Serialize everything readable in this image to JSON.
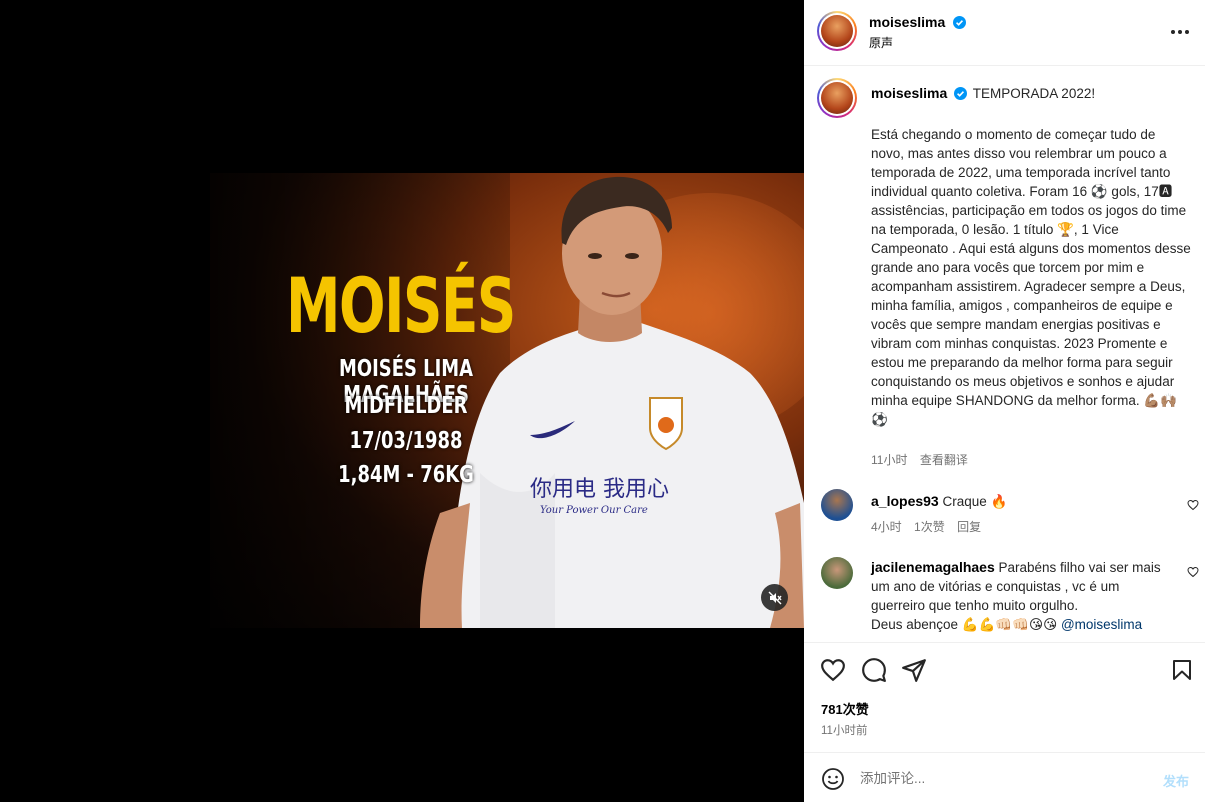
{
  "video": {
    "name": "MOISÉS",
    "full_name": "MOISÉS LIMA MAGALHÃES",
    "position": "MIDFIELDER",
    "birthdate": "17/03/1988",
    "stats": "1,84M - 76KG",
    "shirt_text": "你用电 我用心",
    "shirt_sub": "Your Power Our Care",
    "mute_icon": "volume-muted-icon"
  },
  "header": {
    "username": "moiseslima",
    "verified": true,
    "audio_label": "原声",
    "more_icon": "more-options-icon"
  },
  "caption": {
    "username": "moiseslima",
    "title": "TEMPORADA 2022!",
    "text": "Está chegando o momento de começar tudo de novo, mas antes disso vou relembrar um pouco a temporada de 2022, uma temporada incrível tanto individual quanto coletiva. Foram 16 ⚽ gols, 17🅰 assistências, participação em todos os jogos do time na temporada, 0 lesão. 1 título 🏆, 1 Vice Campeonato . Aqui está alguns dos momentos desse grande ano para vocês que torcem por mim e acompanham assistirem. Agradecer sempre a Deus, minha família, amigos , companheiros de equipe e vocês que sempre mandam energias positivas e vibram com minhas conquistas. 2023 Promente e estou me preparando da melhor forma para seguir conquistando os meus objetivos e sonhos e ajudar minha equipe SHANDONG da melhor forma. 💪🏽🙌🏽⚽",
    "time": "11小时",
    "translate": "查看翻译"
  },
  "comments": [
    {
      "username": "a_lopes93",
      "text": "Craque 🔥",
      "time": "4小时",
      "likes": "1次赞",
      "reply": "回复"
    },
    {
      "username": "jacilenemagalhaes",
      "text": "Parabéns filho vai ser mais um ano de vitórias e conquistas , vc é um guerreiro que tenho muito orgulho.\nDeus abençoe 💪💪👊🏻👊🏻😘😘",
      "mention": "@moiseslima"
    }
  ],
  "actions": {
    "likes": "781次赞",
    "time": "11小时前"
  },
  "add_comment": {
    "placeholder": "添加评论...",
    "post_label": "发布"
  },
  "colors": {
    "title_yellow": "#f5c400",
    "verified_blue": "#0095f6",
    "meta_gray": "#737373",
    "post_disabled": "#b2dffc"
  }
}
